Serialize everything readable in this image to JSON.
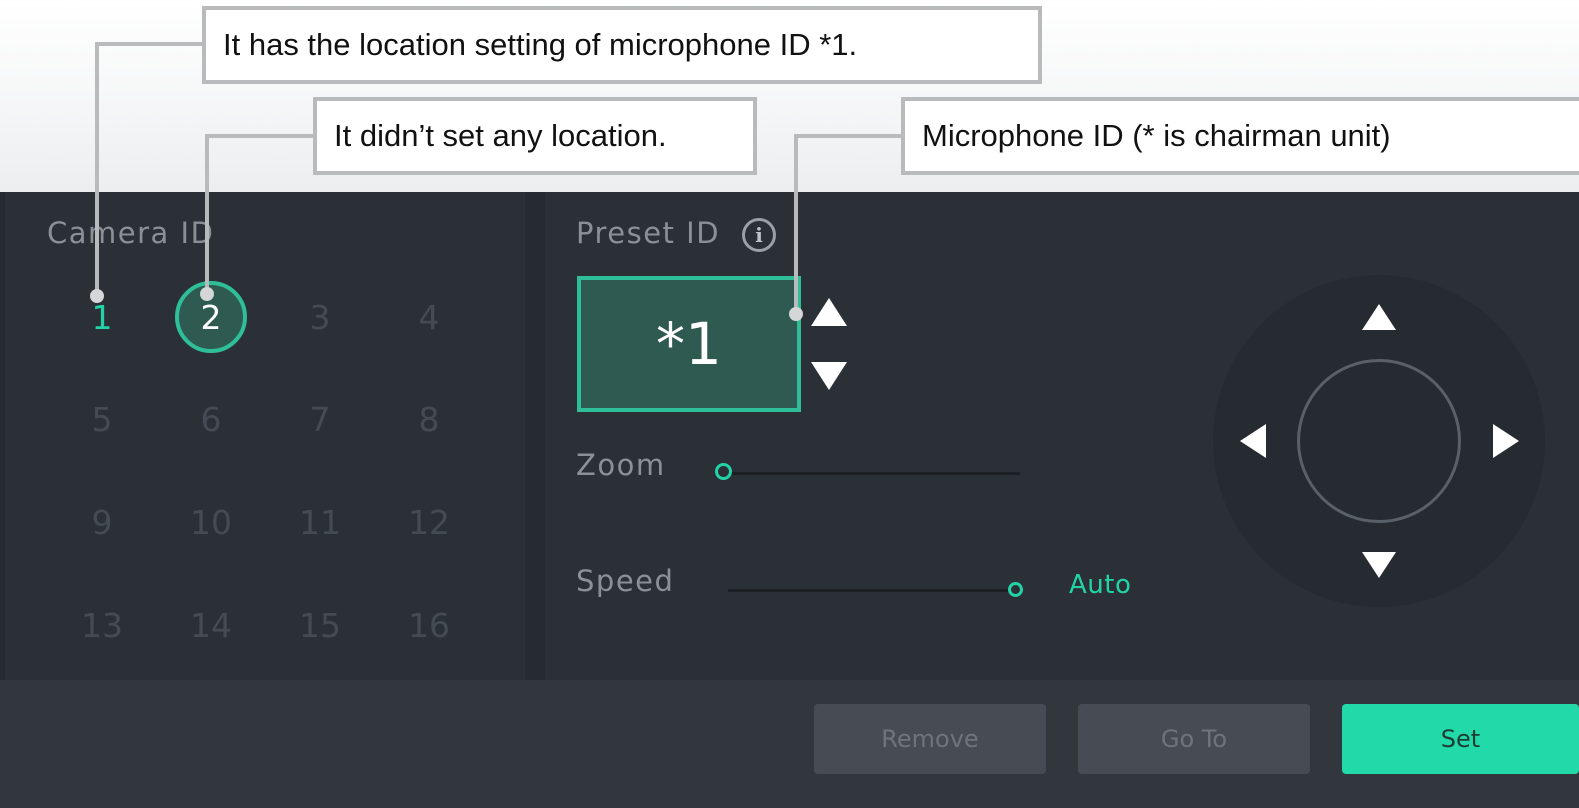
{
  "callouts": {
    "location_set": "It has the location setting of microphone ID *1.",
    "no_location": "It didn’t set any location.",
    "microphone_id": "Microphone ID (* is chairman unit)"
  },
  "camera": {
    "label": "Camera ID",
    "ids": [
      "1",
      "2",
      "3",
      "4",
      "5",
      "6",
      "7",
      "8",
      "9",
      "10",
      "11",
      "12",
      "13",
      "14",
      "15",
      "16"
    ],
    "with_location": "1",
    "selected": "2"
  },
  "preset": {
    "label": "Preset ID",
    "info_icon": "info-icon",
    "value": "*1",
    "up_icon": "triangle-up-icon",
    "down_icon": "triangle-down-icon"
  },
  "zoom": {
    "label": "Zoom",
    "value_fraction": 0.0
  },
  "speed": {
    "label": "Speed",
    "value_fraction": 1.0,
    "value_text": "Auto"
  },
  "ptz": {
    "up_icon": "pan-up-icon",
    "down_icon": "pan-down-icon",
    "left_icon": "pan-left-icon",
    "right_icon": "pan-right-icon"
  },
  "buttons": {
    "remove": "Remove",
    "goto": "Go To",
    "set": "Set"
  },
  "colors": {
    "accent": "#22d3a6",
    "selected_fill": "#2f5a52",
    "primary_button": "#22d9a9"
  }
}
